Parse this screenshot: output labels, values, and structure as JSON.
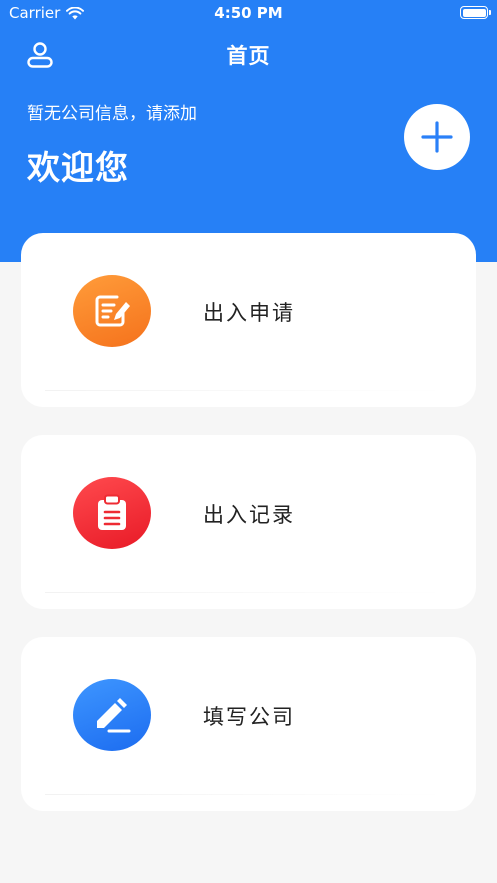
{
  "status_bar": {
    "carrier": "Carrier",
    "time": "4:50 PM"
  },
  "nav": {
    "title": "首页"
  },
  "header": {
    "company_note": "暂无公司信息，请添加",
    "welcome": "欢迎您"
  },
  "colors": {
    "brand": "#2680f6",
    "background": "#f6f6f6",
    "apply_icon": "#f5821f",
    "records_icon": "#f32a33",
    "company_icon": "#2a80f8"
  },
  "menu": [
    {
      "label": "出入申请",
      "icon": "edit-document-icon"
    },
    {
      "label": "出入记录",
      "icon": "clipboard-icon"
    },
    {
      "label": "填写公司",
      "icon": "pen-write-icon"
    }
  ]
}
